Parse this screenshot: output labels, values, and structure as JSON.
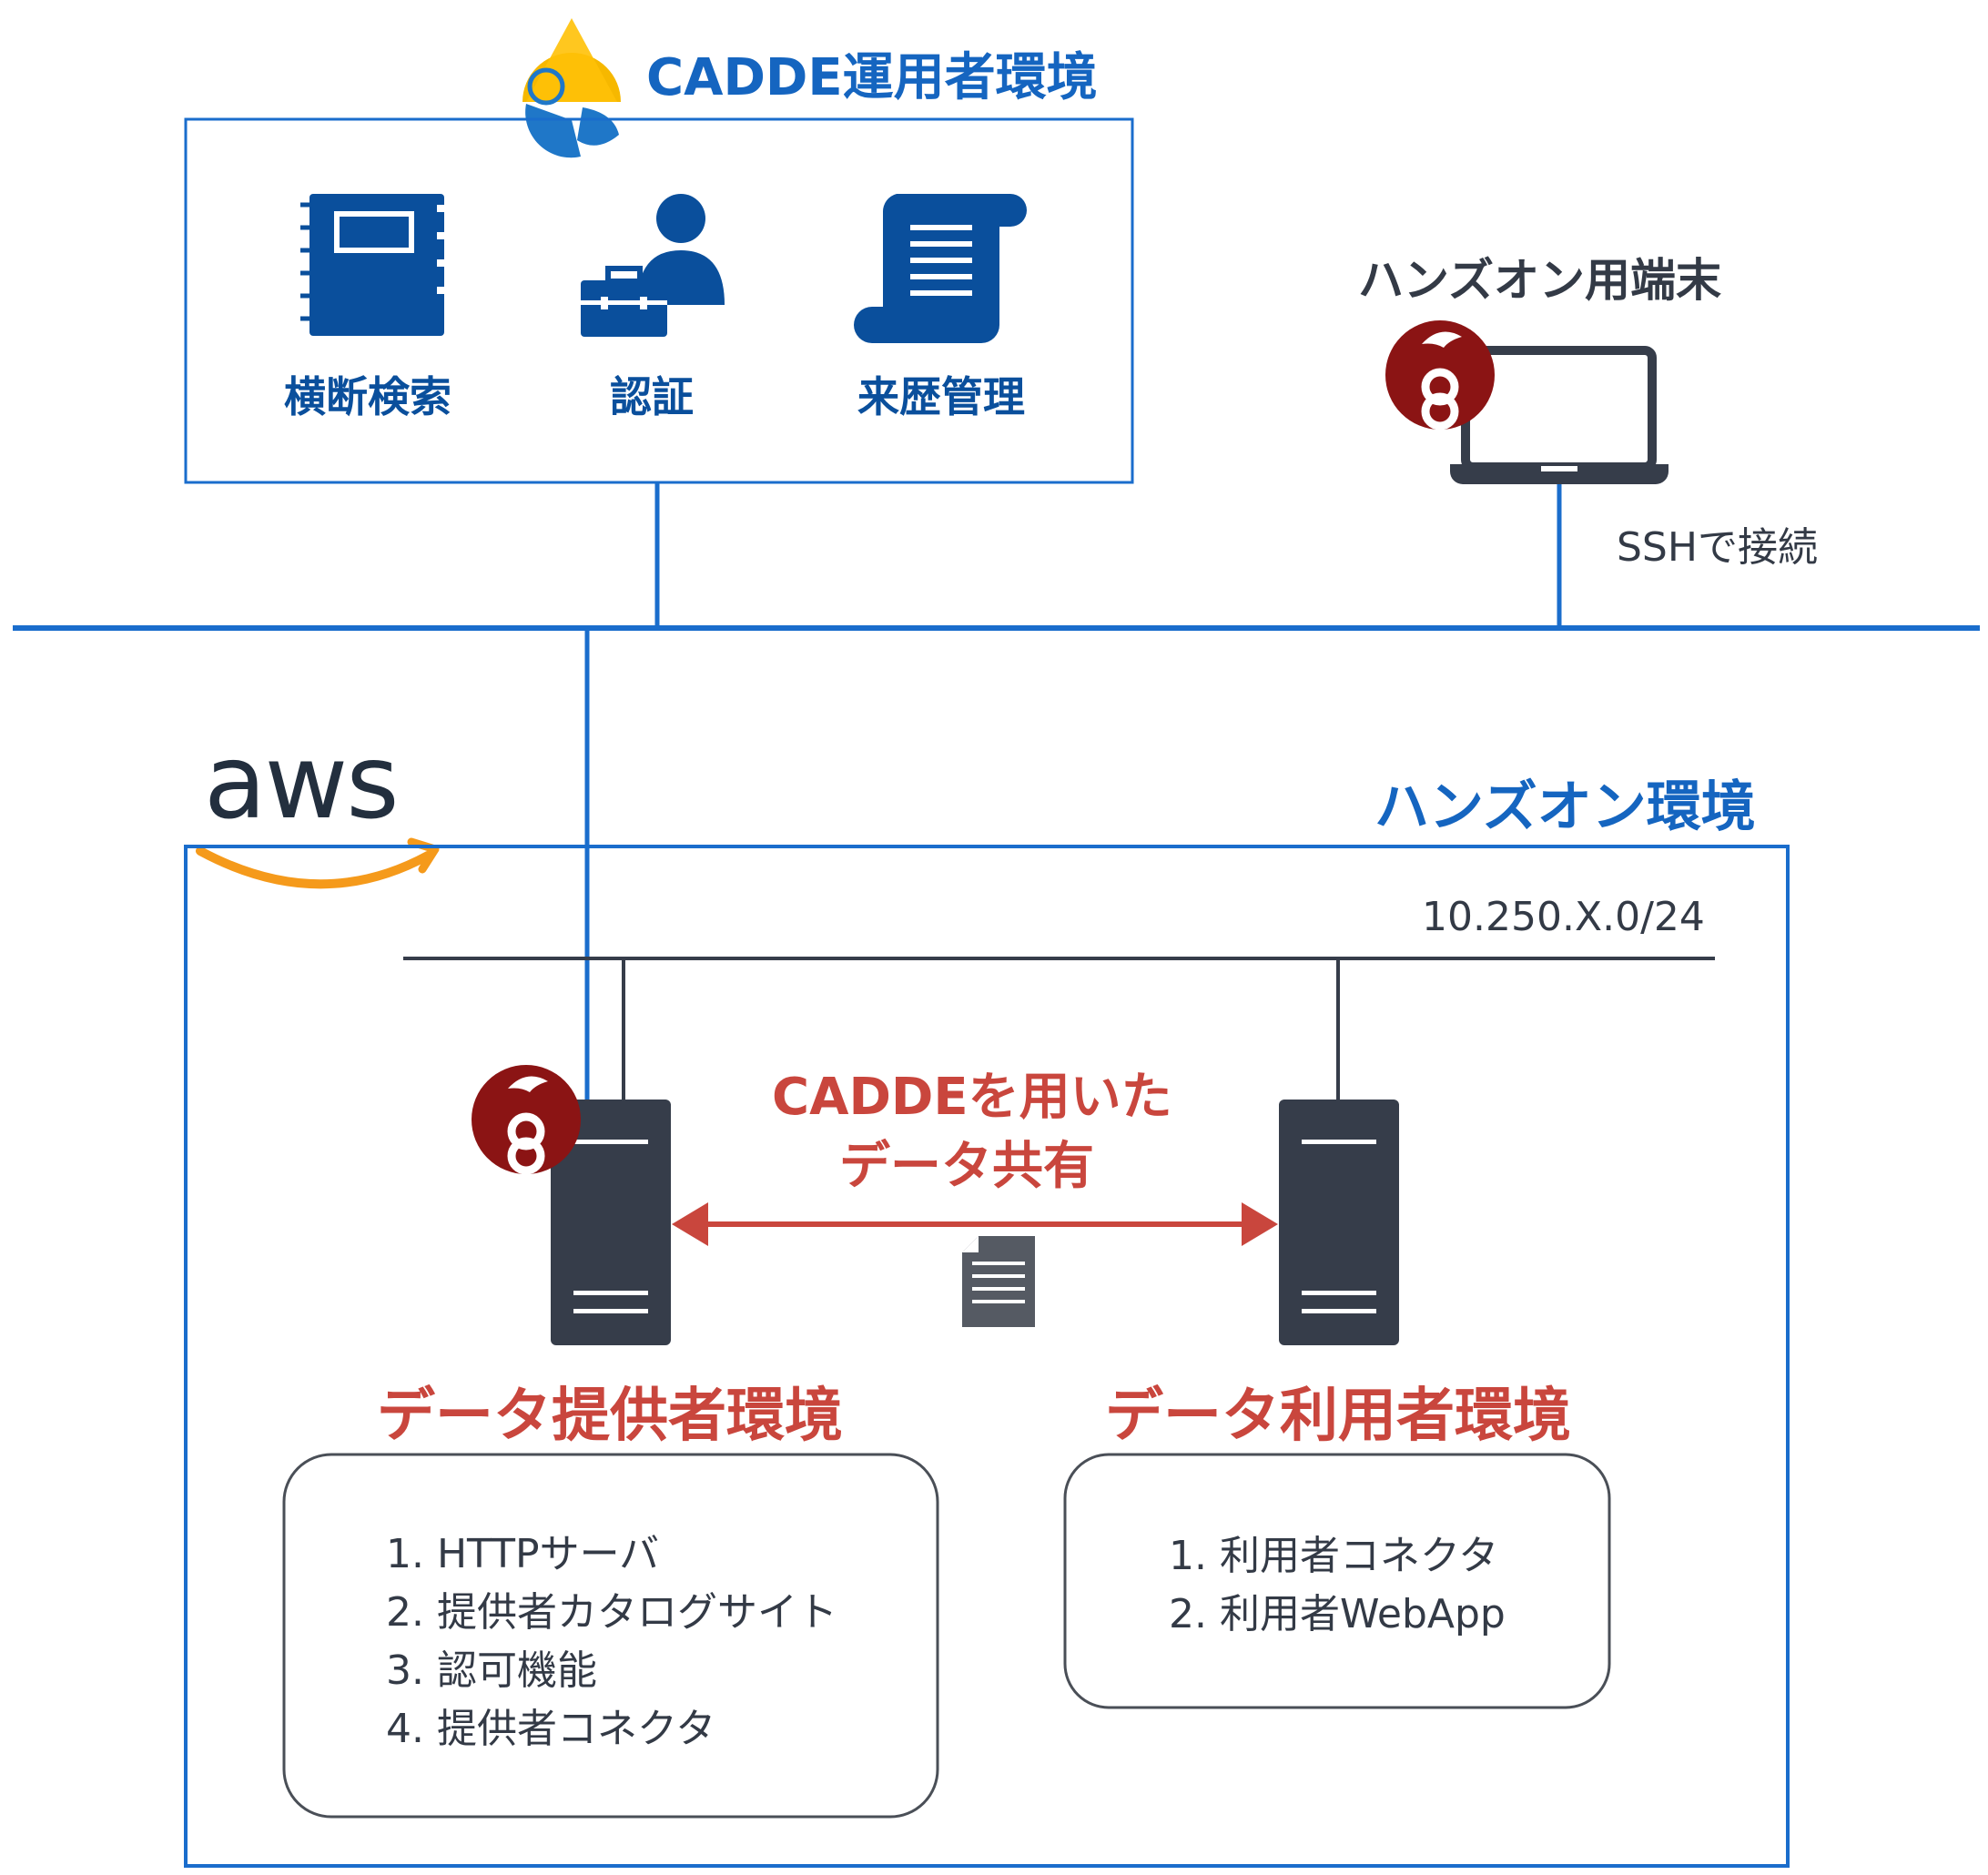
{
  "cadde_operator": {
    "title": "CADDE運用者環境",
    "services": [
      {
        "label": "横断検索",
        "icon": "notebook-icon"
      },
      {
        "label": "認証",
        "icon": "user-briefcase-icon"
      },
      {
        "label": "来歴管理",
        "icon": "scroll-icon"
      }
    ]
  },
  "handson_terminal": {
    "title": "ハンズオン用端末",
    "connection": "SSHで接続",
    "icon": "winscp-icon"
  },
  "aws": {
    "logo_text": "aws",
    "env_title": "ハンズオン環境",
    "subnet": "10.250.X.0/24"
  },
  "sharing": {
    "line1": "CADDEを用いた",
    "line2": "データ共有"
  },
  "provider": {
    "title": "データ提供者環境",
    "items": [
      "1. HTTPサーバ",
      "2. 提供者カタログサイト",
      "3. 認可機能",
      "4. 提供者コネクタ"
    ]
  },
  "consumer": {
    "title": "データ利用者環境",
    "items": [
      "1. 利用者コネクタ",
      "2. 利用者WebApp"
    ]
  },
  "colors": {
    "blue": "#0a4f9c",
    "bright_blue": "#1a6dcc",
    "red": "#c9463d",
    "server": "#363d4a",
    "aws_orange": "#f59a1b",
    "winscp_red": "#8b1414"
  }
}
